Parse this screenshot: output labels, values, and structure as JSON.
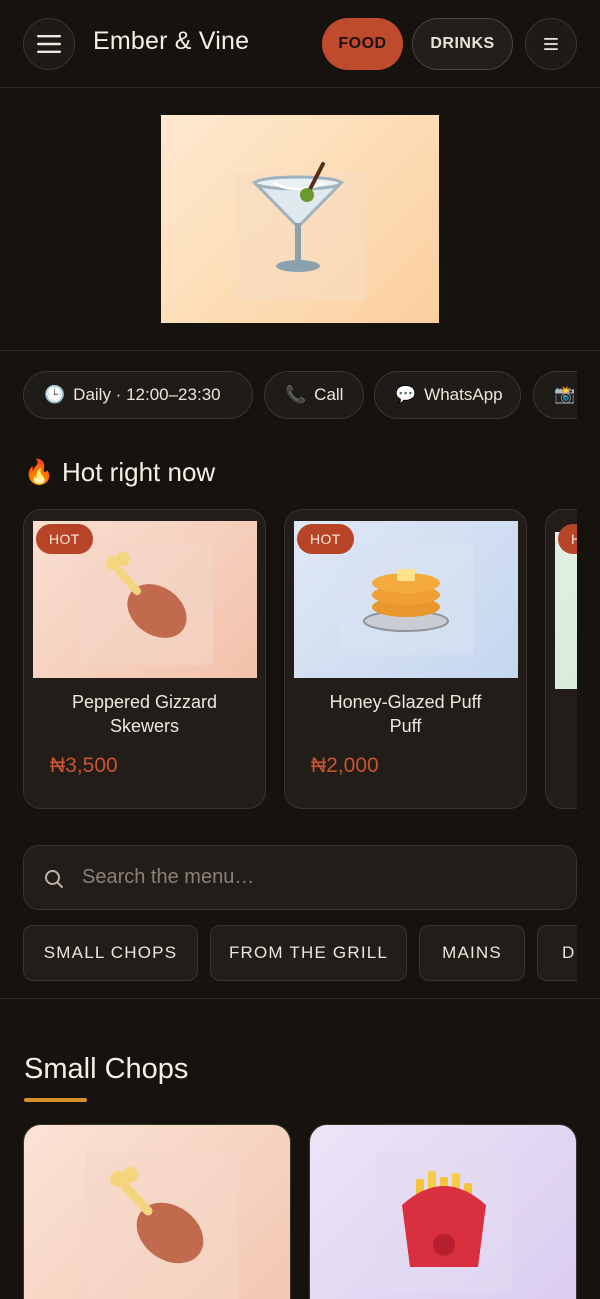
{
  "header": {
    "menu_icon": "hamburger-menu-icon",
    "brand": "Ember & Vine",
    "tabs": [
      {
        "label": "FOOD",
        "active": true
      },
      {
        "label": "DRINKS",
        "active": false
      }
    ],
    "list_icon": "list-icon"
  },
  "hero": {
    "icon": "cocktail-glass-icon"
  },
  "info_chips": [
    {
      "icon": "clock-icon",
      "label": "Daily · 12:00–23:30"
    },
    {
      "icon": "phone-icon",
      "label": "Call"
    },
    {
      "icon": "speech-bubble-icon",
      "label": "WhatsApp"
    },
    {
      "icon": "camera-icon",
      "label": ""
    }
  ],
  "hot": {
    "icon": "fire-icon",
    "title": "Hot right now",
    "items": [
      {
        "badge": "HOT",
        "name": "Peppered Gizzard Skewers",
        "price": "₦3,500",
        "icon": "drumstick-icon"
      },
      {
        "badge": "HOT",
        "name": "Honey-Glazed Puff Puff",
        "price": "₦2,000",
        "icon": "pancakes-icon"
      },
      {
        "badge": "H",
        "name": "",
        "price": "",
        "icon": ""
      }
    ]
  },
  "search": {
    "placeholder": "Search the menu…",
    "value": ""
  },
  "categories": [
    "SMALL CHOPS",
    "FROM THE GRILL",
    "MAINS",
    "DI"
  ],
  "section": {
    "title": "Small Chops",
    "cards": [
      {
        "icon": "drumstick-icon"
      },
      {
        "icon": "fries-icon"
      }
    ]
  },
  "colors": {
    "accent": "#bf4b2c",
    "background": "#16130f",
    "underline": "#d6902f"
  }
}
